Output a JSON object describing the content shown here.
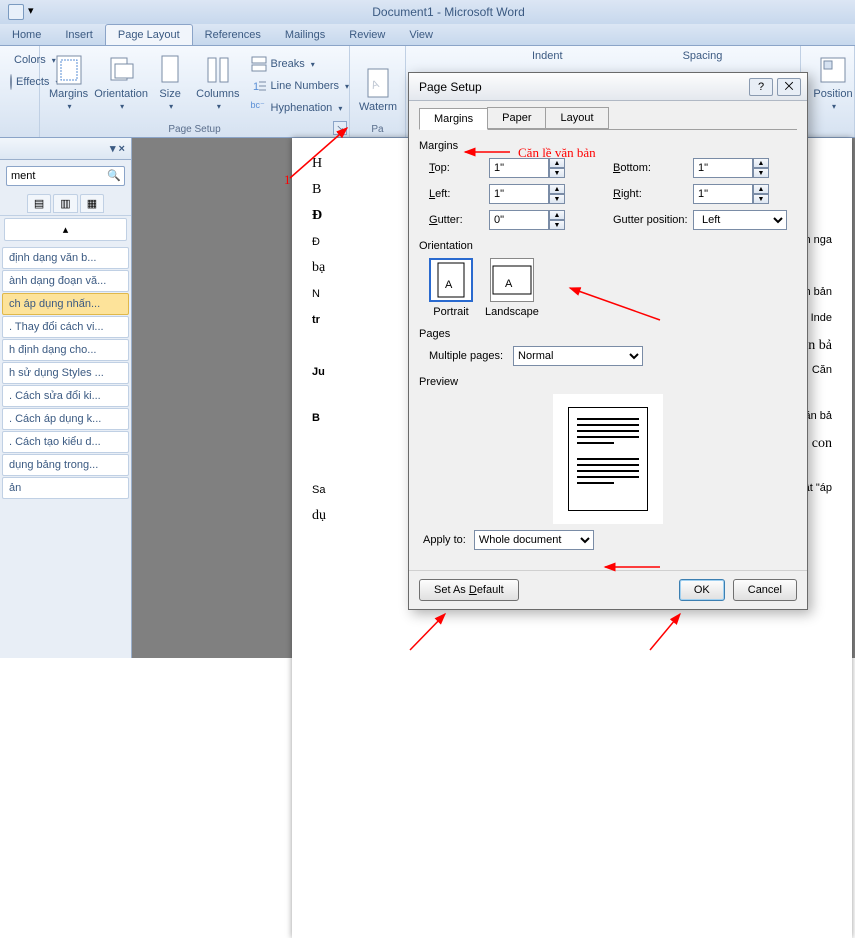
{
  "title": "Document1 - Microsoft Word",
  "tabs": {
    "home": "Home",
    "insert": "Insert",
    "pagelayout": "Page Layout",
    "references": "References",
    "mailings": "Mailings",
    "review": "Review",
    "view": "View"
  },
  "ribbon": {
    "colors": "Colors",
    "effects": "Effects",
    "margins": "Margins",
    "orientation": "Orientation",
    "size": "Size",
    "columns": "Columns",
    "breaks": "Breaks",
    "lineNumbers": "Line Numbers",
    "hyphenation": "Hyphenation",
    "pageSetupGroup": "Page Setup",
    "watermark": "Waterm",
    "indent": "Indent",
    "spacing": "Spacing",
    "position": "Position"
  },
  "nav": {
    "searchPlaceholder": "ment",
    "items": [
      "định dạng văn b...",
      "ành dạng đoạn vă...",
      "ch áp dụng nhấn...",
      ". Thay đổi cách vi...",
      "h định dạng cho...",
      "h sử dụng Styles ...",
      ". Cách sửa đổi ki...",
      ". Cách áp dụng k...",
      ". Cách tạo kiểu d...",
      "dụng bảng trong...",
      "ản"
    ],
    "selectedIndex": 2
  },
  "dialog": {
    "title": "Page Setup",
    "tabs": {
      "margins": "Margins",
      "paper": "Paper",
      "layout": "Layout"
    },
    "marginsLabel": "Margins",
    "topLabel": "Top:",
    "topValue": "1\"",
    "bottomLabel": "Bottom:",
    "bottomValue": "1\"",
    "leftLabel": "Left:",
    "leftValue": "1\"",
    "rightLabel": "Right:",
    "rightValue": "1\"",
    "gutterLabel": "Gutter:",
    "gutterValue": "0\"",
    "gutterPosLabel": "Gutter position:",
    "gutterPosValue": "Left",
    "orientationLabel": "Orientation",
    "portrait": "Portrait",
    "landscape": "Landscape",
    "pagesLabel": "Pages",
    "multiplePages": "Multiple pages:",
    "multiplePagesValue": "Normal",
    "previewLabel": "Preview",
    "applyTo": "Apply to:",
    "applyToValue": "Whole document",
    "setDefault": "Set As Default",
    "ok": "OK",
    "cancel": "Cancel"
  },
  "annotations": {
    "marginNote": "Căn lề văn bản",
    "num1": "1"
  },
  "doc_fragments": {
    "l1": "H",
    "l2": "B",
    "l3": "Đ",
    "l4": "Đ",
    "l5": "hiện nga",
    "l6": "bạ",
    "l7": "N",
    "l8": "văn bản",
    "l9": "tr",
    "l10": "c Inde",
    "l11": "an văn bả",
    "l12": "Ju",
    "l13": "ht: Căn",
    "l14": "B",
    "l15": "i văn bả",
    "l16": "iền con",
    "l17": "Sa",
    "l18": "ật \"áp",
    "l19": "dụ"
  }
}
